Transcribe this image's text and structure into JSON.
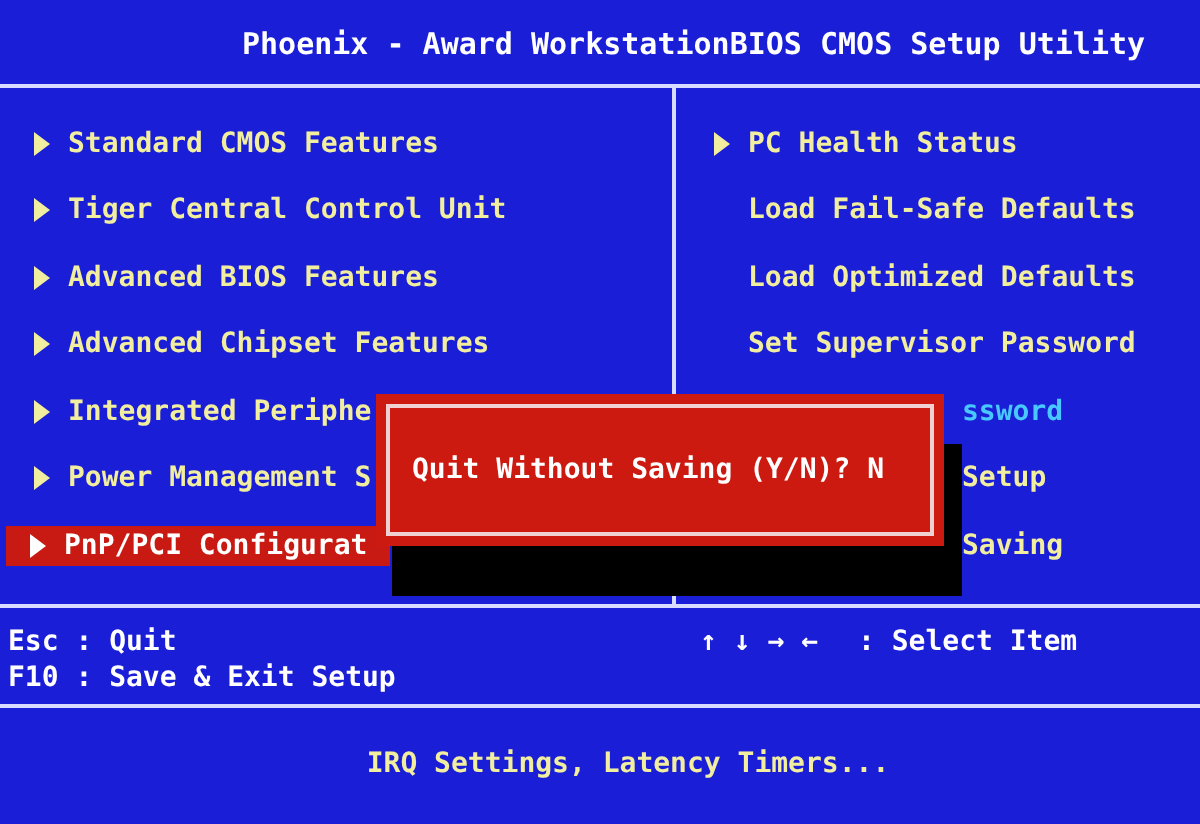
{
  "title": "Phoenix - Award WorkstationBIOS CMOS Setup Utility",
  "left_menu": [
    {
      "label": "Standard CMOS Features",
      "submenu": true,
      "selected": false
    },
    {
      "label": "Tiger Central Control Unit",
      "submenu": true,
      "selected": false
    },
    {
      "label": "Advanced BIOS Features",
      "submenu": true,
      "selected": false
    },
    {
      "label": "Advanced Chipset Features",
      "submenu": true,
      "selected": false
    },
    {
      "label": "Integrated Periphe",
      "submenu": true,
      "selected": false
    },
    {
      "label": "Power Management S",
      "submenu": true,
      "selected": false
    },
    {
      "label": "PnP/PCI Configurat",
      "submenu": true,
      "selected": true
    }
  ],
  "right_menu": [
    {
      "label": "PC Health Status",
      "submenu": true,
      "covered": false,
      "color": "#f2eea0"
    },
    {
      "label": "Load Fail-Safe Defaults",
      "submenu": false,
      "covered": false,
      "color": "#f2eea0"
    },
    {
      "label": "Load Optimized Defaults",
      "submenu": false,
      "covered": false,
      "color": "#f2eea0"
    },
    {
      "label": "Set Supervisor Password",
      "submenu": false,
      "covered": false,
      "color": "#f2eea0"
    },
    {
      "label": "ssword",
      "submenu": false,
      "covered": true,
      "color": "#48c8ff"
    },
    {
      "label": "Setup",
      "submenu": false,
      "covered": true,
      "color": "#f2eea0"
    },
    {
      "label": "Saving",
      "submenu": false,
      "covered": true,
      "color": "#f2eea0"
    }
  ],
  "dialog": {
    "message": "Quit Without Saving (Y/N)? N"
  },
  "keys_left": [
    "Esc : Quit",
    "F10 : Save & Exit Setup"
  ],
  "keys_right": {
    "arrows": "↑ ↓ → ←",
    "action": ": Select Item"
  },
  "help": "IRQ Settings, Latency Timers..."
}
